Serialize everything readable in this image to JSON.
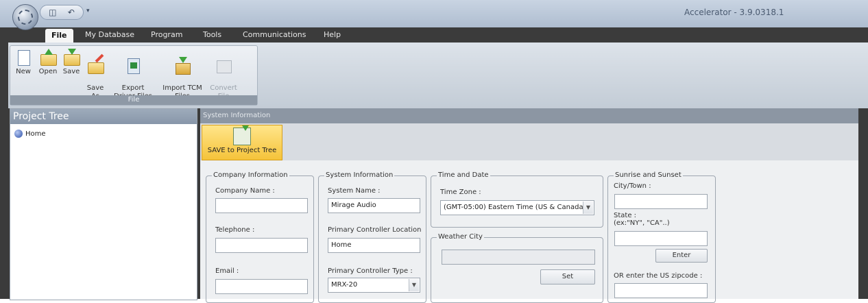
{
  "app": {
    "title": "Accelerator - 3.9.0318.1"
  },
  "quick_access": {
    "icons": [
      "save-icon",
      "undo-icon"
    ],
    "dropdown_glyph": "▾"
  },
  "menu_tabs": [
    "File",
    "My Database",
    "Program",
    "Tools",
    "Communications",
    "Help"
  ],
  "ribbon": {
    "group_label": "File",
    "buttons": [
      {
        "label": "New",
        "enabled": true
      },
      {
        "label": "Open",
        "enabled": true
      },
      {
        "label": "Save",
        "enabled": true
      },
      {
        "label": "Save\nAs",
        "enabled": true
      },
      {
        "label": "Export\nDriver Files",
        "enabled": true
      },
      {
        "label": "Import TCM\nFiles",
        "enabled": true
      },
      {
        "label": "Convert\nFile",
        "enabled": false
      }
    ]
  },
  "project_tree": {
    "title": "Project Tree",
    "items": [
      "Home"
    ]
  },
  "main": {
    "header": "System Information",
    "save_button": "SAVE to Project Tree",
    "company": {
      "legend": "Company Information",
      "name_label": "Company Name :",
      "name_value": "",
      "phone_label": "Telephone :",
      "phone_value": "",
      "email_label": "Email :",
      "email_value": ""
    },
    "system": {
      "legend": "System Information",
      "name_label": "System Name :",
      "name_value": "Mirage Audio",
      "location_label": "Primary Controller Location",
      "location_value": "Home",
      "type_label": "Primary Controller Type :",
      "type_value": "MRX-20"
    },
    "time": {
      "legend": "Time and Date",
      "zone_label": "Time Zone :",
      "zone_value": "(GMT-05:00) Eastern Time (US & Canada"
    },
    "weather": {
      "legend": "Weather City",
      "value": "",
      "set_button": "Set"
    },
    "sun": {
      "legend": "Sunrise and Sunset",
      "city_label": "City/Town :",
      "city_value": "",
      "state_label": "State :",
      "state_hint": "(ex:\"NY\", \"CA\"..)",
      "state_value": "",
      "enter_button": "Enter",
      "zip_label": "OR enter the US zipcode :",
      "zip_value": ""
    }
  }
}
